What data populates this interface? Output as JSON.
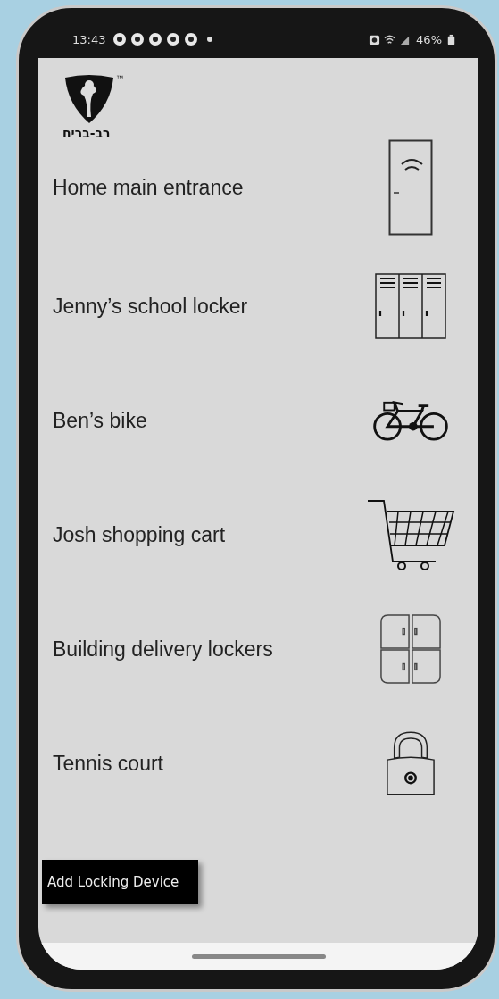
{
  "status_bar": {
    "time": "13:43",
    "battery": "46%"
  },
  "logo": {
    "name": "רב-בריח",
    "mark": "™"
  },
  "devices": [
    {
      "name": "Home main entrance",
      "kind": "door"
    },
    {
      "name": "Jenny’s school locker",
      "kind": "lockers"
    },
    {
      "name": "Ben’s bike",
      "kind": "bike"
    },
    {
      "name": "Josh shopping cart",
      "kind": "cart"
    },
    {
      "name": "Building delivery lockers",
      "kind": "cabinet"
    },
    {
      "name": "Tennis court",
      "kind": "padlock"
    }
  ],
  "add_button": "Add Locking Device"
}
